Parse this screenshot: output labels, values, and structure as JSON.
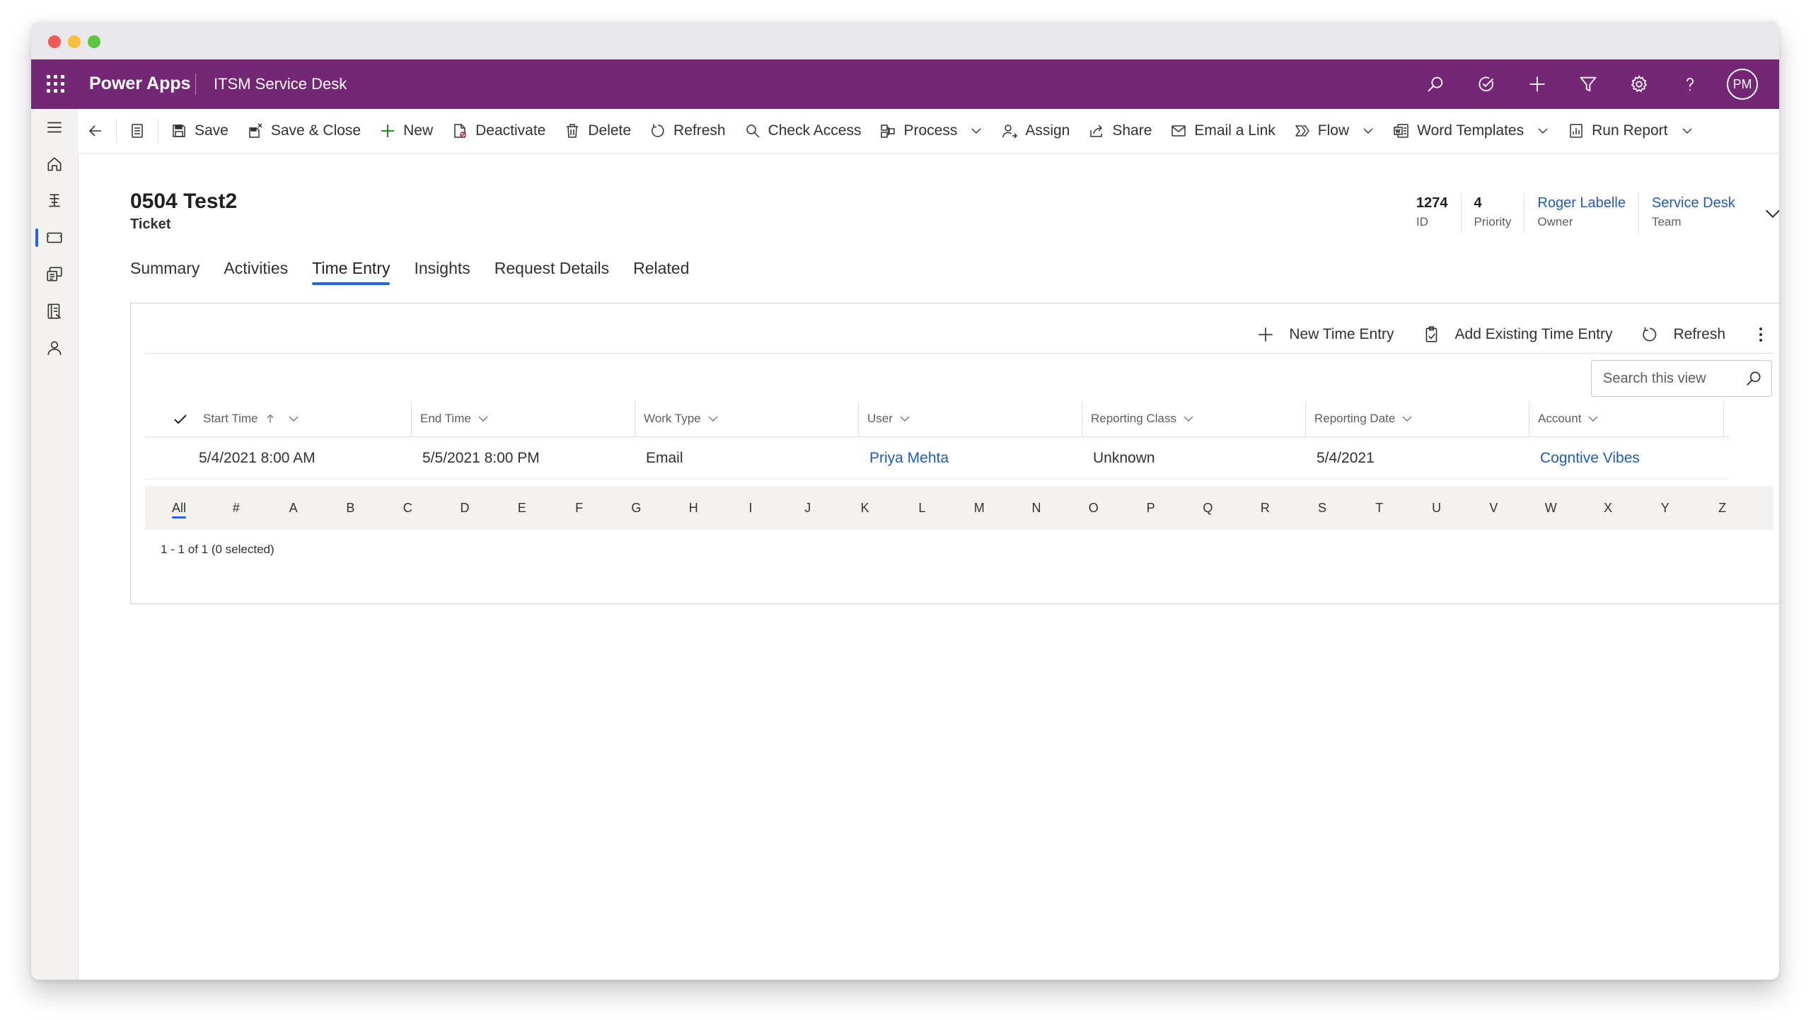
{
  "topbar": {
    "brand": "Power Apps",
    "app_name": "ITSM Service Desk",
    "user_initials": "PM",
    "icons": [
      "search-icon",
      "task-icon",
      "plus-icon",
      "filter-icon",
      "gear-icon",
      "help-icon"
    ]
  },
  "left_nav": {
    "items": [
      "home-icon",
      "pinned-icon",
      "ticket-icon",
      "knowledge-icon",
      "catalog-icon",
      "person-icon"
    ],
    "active": "ticket-icon"
  },
  "command_bar": {
    "save": "Save",
    "save_close": "Save & Close",
    "new": "New",
    "deactivate": "Deactivate",
    "delete": "Delete",
    "refresh": "Refresh",
    "check_access": "Check Access",
    "process": "Process",
    "assign": "Assign",
    "share": "Share",
    "email_link": "Email a Link",
    "flow": "Flow",
    "word_templates": "Word Templates",
    "run_report": "Run Report"
  },
  "record": {
    "title": "0504 Test2",
    "type": "Ticket"
  },
  "header_fields": [
    {
      "value": "1274",
      "label": "ID"
    },
    {
      "value": "4",
      "label": "Priority"
    },
    {
      "value": "Roger Labelle",
      "label": "Owner"
    },
    {
      "value": "Service Desk",
      "label": "Team"
    }
  ],
  "tabs": [
    "Summary",
    "Activities",
    "Time Entry",
    "Insights",
    "Request Details",
    "Related"
  ],
  "active_tab": "Time Entry",
  "grid": {
    "toolbar": {
      "new_entry": "New Time Entry",
      "add_existing": "Add Existing Time Entry",
      "refresh": "Refresh"
    },
    "search_placeholder": "Search this view",
    "columns": [
      "Start Time",
      "End Time",
      "Work Type",
      "User",
      "Reporting Class",
      "Reporting Date",
      "Account"
    ],
    "rows": [
      [
        "5/4/2021 8:00 AM",
        "5/5/2021 8:00 PM",
        "Email",
        "Priya Mehta",
        "Unknown",
        "5/4/2021",
        "Cogntive Vibes"
      ]
    ],
    "jump_letters": [
      "All",
      "#",
      "A",
      "B",
      "C",
      "D",
      "E",
      "F",
      "G",
      "H",
      "I",
      "J",
      "K",
      "L",
      "M",
      "N",
      "O",
      "P",
      "Q",
      "R",
      "S",
      "T",
      "U",
      "V",
      "W",
      "X",
      "Y",
      "Z"
    ],
    "footer": "1 - 1 of 1 (0 selected)"
  },
  "colors": {
    "header_bg": "#742774",
    "accent": "#2266e3",
    "link": "#1f5bbf"
  }
}
